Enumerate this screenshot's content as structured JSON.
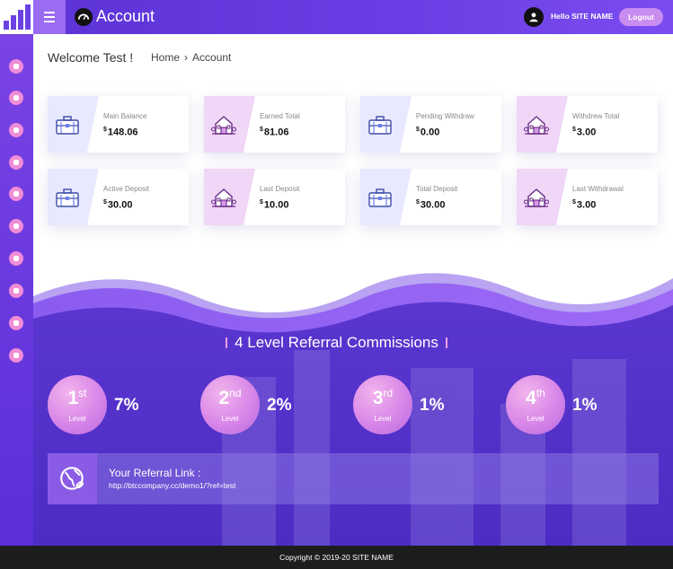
{
  "header": {
    "title": "Account",
    "greeting": "Hello SITE NAME",
    "logout_label": "Logout"
  },
  "sidebar": {
    "icons": [
      "dashboard-icon",
      "edit-icon",
      "deposit-icon",
      "history-icon",
      "chart-icon",
      "lock-icon",
      "user-icon",
      "wallet-icon",
      "referral-icon",
      "share-icon"
    ]
  },
  "main": {
    "welcome": "Welcome Test !",
    "breadcrumb": {
      "home": "Home",
      "separator": "›",
      "current": "Account"
    }
  },
  "cards": [
    {
      "label": "Main Balance",
      "currency": "$",
      "value": "148.06",
      "icon": "briefcase-icon",
      "tone": "blue"
    },
    {
      "label": "Earned Total",
      "currency": "$",
      "value": "81.06",
      "icon": "house-icon",
      "tone": "pink"
    },
    {
      "label": "Pending Withdraw",
      "currency": "$",
      "value": "0.00",
      "icon": "briefcase-icon",
      "tone": "blue"
    },
    {
      "label": "Withdrew Total",
      "currency": "$",
      "value": "3.00",
      "icon": "house-icon",
      "tone": "pink"
    },
    {
      "label": "Active Deposit",
      "currency": "$",
      "value": "30.00",
      "icon": "briefcase-icon",
      "tone": "blue"
    },
    {
      "label": "Last Deposit",
      "currency": "$",
      "value": "10.00",
      "icon": "house-icon",
      "tone": "pink"
    },
    {
      "label": "Total Deposit",
      "currency": "$",
      "value": "30.00",
      "icon": "briefcase-icon",
      "tone": "blue"
    },
    {
      "label": "Last Withdrawal",
      "currency": "$",
      "value": "3.00",
      "icon": "house-icon",
      "tone": "pink"
    }
  ],
  "referral": {
    "title": "4 Level Referral Commissions",
    "levels": [
      {
        "number": "1",
        "suffix": "st",
        "label": "Level",
        "percent": "7%"
      },
      {
        "number": "2",
        "suffix": "nd",
        "label": "Level",
        "percent": "2%"
      },
      {
        "number": "3",
        "suffix": "rd",
        "label": "Level",
        "percent": "1%"
      },
      {
        "number": "4",
        "suffix": "th",
        "label": "Level",
        "percent": "1%"
      }
    ],
    "link_label": "Your Referral Link :",
    "link_url": "http://btccompany.cc/demo1/?ref=test"
  },
  "footer": {
    "copyright": "Copyright © 2019-20 SITE NAME"
  },
  "colors": {
    "primary": "#5b32d6",
    "accent_pink": "#f08dd6",
    "logout_bg": "#c98cf0",
    "footer_bg": "#1d1d1d"
  }
}
